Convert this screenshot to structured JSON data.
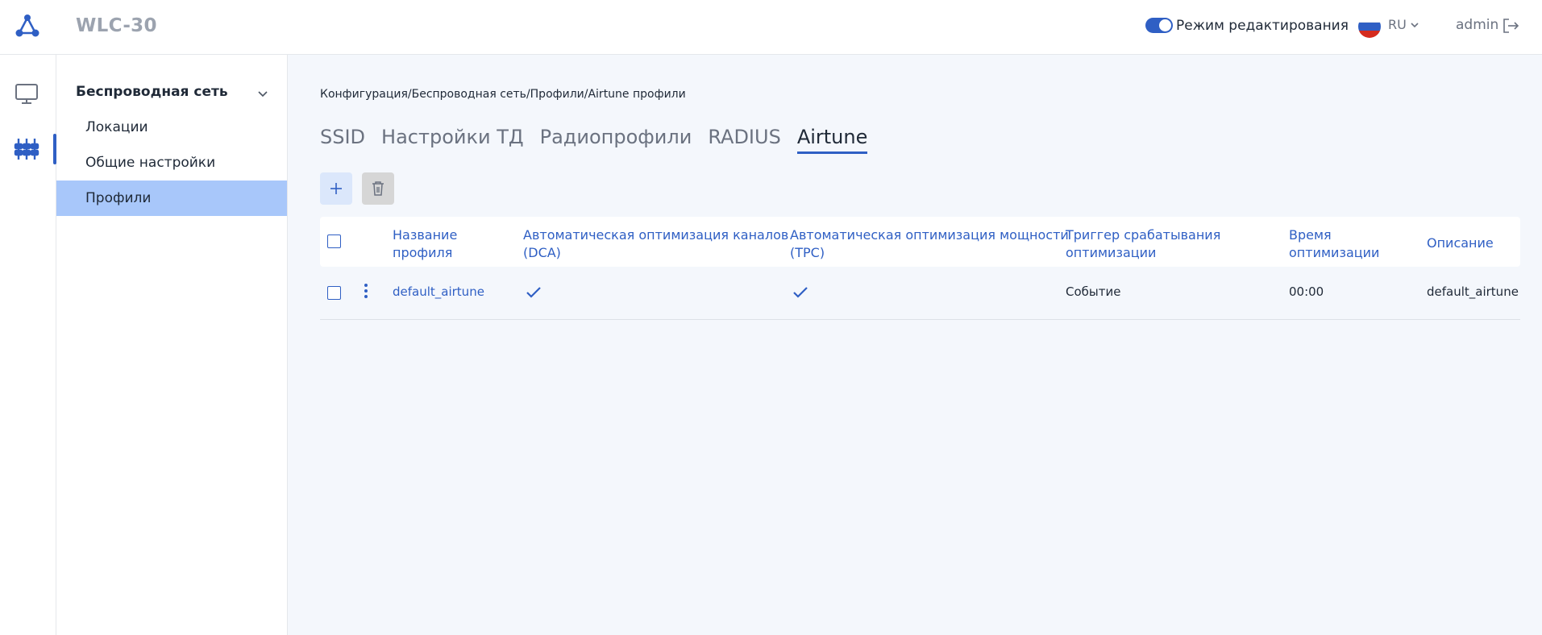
{
  "header": {
    "app_title": "WLC-30",
    "edit_mode_label": "Режим редактирования",
    "edit_mode_on": true,
    "language": "RU",
    "user": "admin",
    "accent_color": "#2f5fc4"
  },
  "rail": {
    "items": [
      {
        "name": "monitor-icon",
        "active": false
      },
      {
        "name": "configuration-icon",
        "active": true
      }
    ]
  },
  "sidebar": {
    "group": {
      "label": "Беспроводная сеть",
      "expanded": true
    },
    "items": [
      {
        "label": "Локации",
        "active": false
      },
      {
        "label": "Общие настройки",
        "active": false
      },
      {
        "label": "Профили",
        "active": true
      }
    ]
  },
  "main": {
    "breadcrumb": "Конфигурация/Беспроводная сеть/Профили/Airtune профили",
    "tabs": [
      {
        "label": "SSID",
        "active": false
      },
      {
        "label": "Настройки ТД",
        "active": false
      },
      {
        "label": "Радиопрофили",
        "active": false
      },
      {
        "label": "RADIUS",
        "active": false
      },
      {
        "label": "Airtune",
        "active": true
      }
    ],
    "toolbar": {
      "add": "add-icon",
      "delete": "trash-icon"
    },
    "table": {
      "columns": [
        {
          "line1": "Название",
          "line2": "профиля"
        },
        {
          "line1": "Автоматическая оптимизация каналов",
          "line2": "(DCA)"
        },
        {
          "line1": "Автоматическая оптимизация мощности",
          "line2": "(TPC)"
        },
        {
          "line1": "Триггер срабатывания",
          "line2": "оптимизации"
        },
        {
          "line1": "Время",
          "line2": "оптимизации"
        },
        {
          "line1": "Описание",
          "line2": ""
        }
      ],
      "rows": [
        {
          "name": "default_airtune",
          "dca": true,
          "tpc": true,
          "trigger": "Событие",
          "time": "00:00",
          "description": "default_airtune"
        }
      ]
    }
  }
}
